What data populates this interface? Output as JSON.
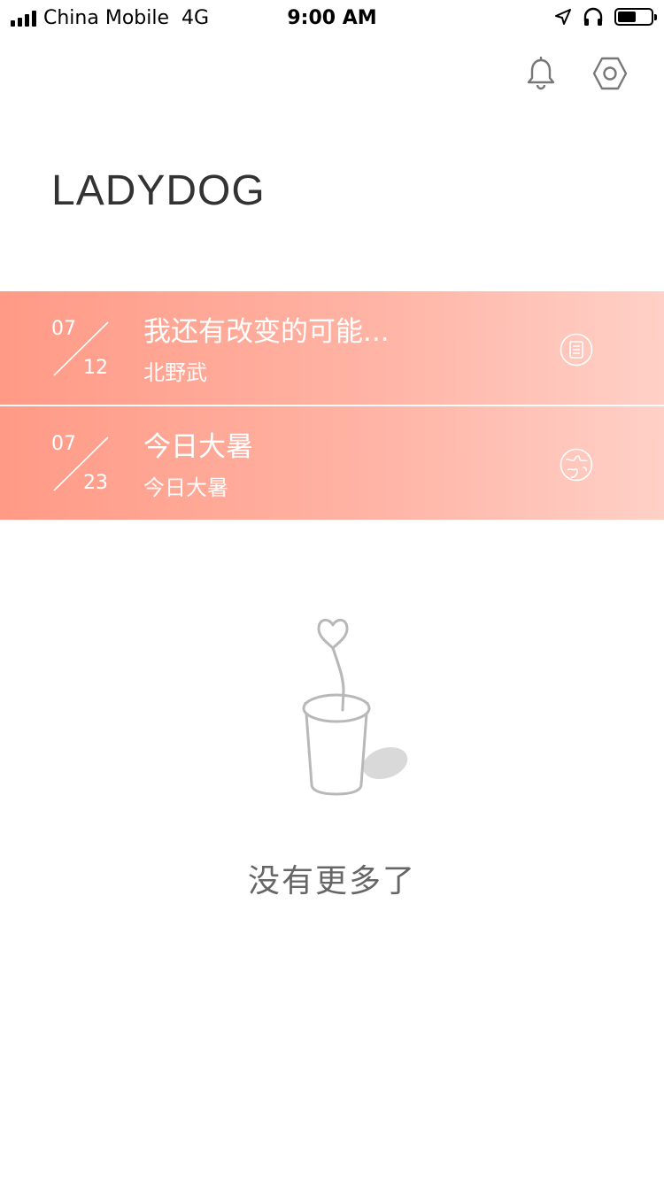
{
  "status_bar": {
    "carrier": "China Mobile",
    "network": "4G",
    "time": "9:00 AM",
    "icons": [
      "location-arrow-icon",
      "headphones-icon",
      "battery-icon"
    ],
    "battery_level": 0.55
  },
  "header": {
    "icons": [
      "bell-icon",
      "settings-hexagon-icon"
    ],
    "title": "LADYDOG"
  },
  "colors": {
    "card_gradient_start": "#ff9a86",
    "card_gradient_end": "#ffd0c7",
    "text_dark": "#333333",
    "text_muted": "#666666"
  },
  "items": [
    {
      "month": "07",
      "day": "12",
      "title": "我还有改变的可能...",
      "subtitle": "北野武",
      "icon": "document-icon"
    },
    {
      "month": "07",
      "day": "23",
      "title": "今日大暑",
      "subtitle": "今日大暑",
      "icon": "globe-icon"
    }
  ],
  "empty_state": {
    "illustration": "cup-with-heart-icon",
    "message": "没有更多了"
  }
}
